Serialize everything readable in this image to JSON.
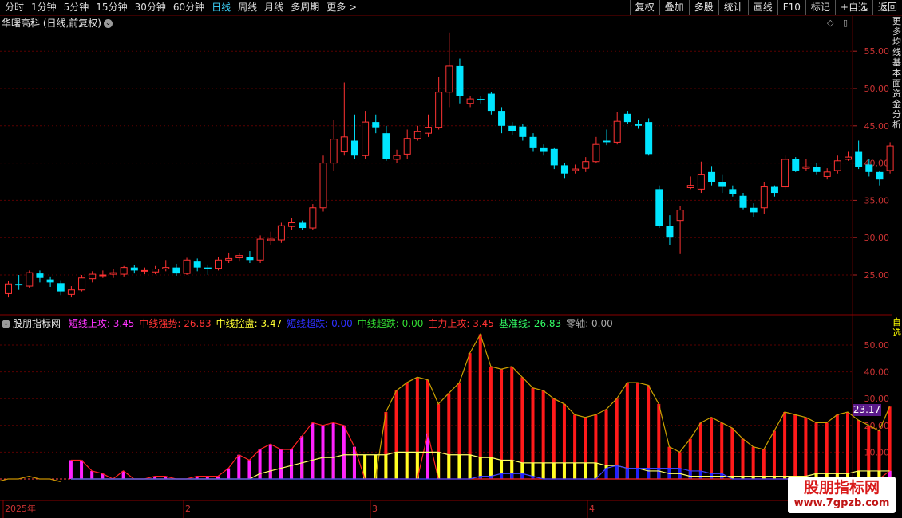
{
  "toolbar": {
    "periods": [
      "分时",
      "1分钟",
      "5分钟",
      "15分钟",
      "30分钟",
      "60分钟",
      "日线",
      "周线",
      "月线",
      "多周期",
      "更多 >"
    ],
    "active_period": "日线",
    "tools": [
      "复权",
      "叠加",
      "多股",
      "统计",
      "画线",
      "F10",
      "标记",
      "+自选",
      "返回"
    ]
  },
  "main_panel": {
    "title": "华曙高科 (日线,前复权)",
    "title_icon": "chevron-down-icon",
    "price_axis": [
      "55.00",
      "50.00",
      "45.00",
      "40.00",
      "35.00",
      "30.00",
      "25.00"
    ],
    "side_text": "更多均线基本面资金分析"
  },
  "indicator_panel": {
    "name": "股朋指标网",
    "items": [
      {
        "label": "短线上攻: ",
        "value": "3.45",
        "color": "#ff33ff"
      },
      {
        "label": "中线强势: ",
        "value": "26.83",
        "color": "#ff3333"
      },
      {
        "label": "中线控盘: ",
        "value": "3.47",
        "color": "#ffff33"
      },
      {
        "label": "短线超跌: ",
        "value": "0.00",
        "color": "#2f2fff"
      },
      {
        "label": "中线超跌: ",
        "value": "0.00",
        "color": "#33dd33"
      },
      {
        "label": "主力上攻: ",
        "value": "3.45",
        "color": "#ff3333"
      },
      {
        "label": "基准线: ",
        "value": "26.83",
        "color": "#33ff66"
      },
      {
        "label": "零轴: ",
        "value": "0.00",
        "color": "#aaaaaa"
      }
    ],
    "axis": [
      "50.00",
      "40.00",
      "30.00",
      "20.00",
      "10.00"
    ],
    "current_value": "23.17",
    "side_text": "自选"
  },
  "time_axis": [
    "2025年",
    "2",
    "3",
    "4"
  ],
  "watermark": {
    "line1": "股朋指标网",
    "line2": "www.7gpzb.com"
  },
  "colors": {
    "up": "#ff3333",
    "down": "#00e5ff",
    "grid": "#5a0000",
    "magenta": "#ff22ff",
    "yellow": "#ffff22",
    "blue": "#2020ff"
  },
  "chart_data": {
    "type": "candlestick",
    "candles": [
      [
        22.5,
        23.8,
        24.2,
        22.0
      ],
      [
        23.8,
        23.6,
        25.0,
        23.0
      ],
      [
        23.5,
        25.3,
        25.6,
        23.2
      ],
      [
        25.2,
        24.6,
        25.6,
        24.0
      ],
      [
        24.4,
        24.0,
        24.8,
        23.4
      ],
      [
        23.9,
        22.8,
        24.3,
        22.3
      ],
      [
        22.4,
        23.0,
        23.5,
        22.0
      ],
      [
        23.0,
        24.6,
        25.0,
        22.8
      ],
      [
        24.5,
        25.1,
        25.5,
        24.0
      ],
      [
        25.0,
        25.0,
        25.6,
        24.6
      ],
      [
        25.1,
        25.3,
        25.8,
        24.6
      ],
      [
        25.1,
        26.0,
        26.2,
        24.8
      ],
      [
        26.0,
        25.6,
        26.3,
        25.2
      ],
      [
        25.6,
        25.6,
        26.0,
        25.1
      ],
      [
        25.4,
        25.8,
        26.2,
        25.1
      ],
      [
        25.8,
        26.0,
        27.0,
        25.5
      ],
      [
        26.0,
        25.2,
        26.5,
        24.9
      ],
      [
        25.2,
        27.0,
        27.3,
        25.0
      ],
      [
        26.8,
        26.0,
        27.2,
        25.5
      ],
      [
        26.0,
        25.8,
        26.4,
        25.0
      ],
      [
        25.9,
        27.0,
        27.4,
        25.6
      ],
      [
        27.0,
        27.2,
        28.0,
        26.6
      ],
      [
        27.3,
        27.6,
        28.0,
        26.8
      ],
      [
        27.4,
        27.0,
        28.2,
        26.6
      ],
      [
        27.0,
        29.8,
        30.3,
        26.6
      ],
      [
        29.6,
        29.8,
        30.8,
        29.0
      ],
      [
        29.7,
        31.6,
        32.0,
        29.3
      ],
      [
        31.5,
        32.0,
        32.6,
        31.0
      ],
      [
        32.0,
        31.3,
        32.3,
        31.0
      ],
      [
        31.3,
        34.0,
        34.5,
        31.0
      ],
      [
        34.0,
        40.0,
        41.0,
        33.5
      ],
      [
        40.0,
        43.2,
        45.8,
        39.0
      ],
      [
        41.5,
        43.5,
        50.8,
        41.0
      ],
      [
        43.0,
        41.0,
        46.5,
        40.5
      ],
      [
        41.0,
        45.5,
        47.0,
        40.5
      ],
      [
        45.5,
        44.8,
        46.5,
        44.0
      ],
      [
        44.0,
        40.5,
        45.0,
        40.3
      ],
      [
        40.5,
        41.0,
        41.8,
        40.0
      ],
      [
        41.2,
        43.3,
        44.5,
        40.5
      ],
      [
        43.3,
        44.2,
        45.0,
        43.0
      ],
      [
        44.0,
        44.8,
        46.5,
        43.5
      ],
      [
        44.8,
        49.5,
        51.5,
        44.5
      ],
      [
        49.5,
        53.0,
        57.5,
        47.5
      ],
      [
        53.0,
        49.0,
        54.0,
        48.0
      ],
      [
        48.0,
        48.6,
        49.0,
        47.5
      ],
      [
        48.6,
        48.5,
        49.0,
        48.0
      ],
      [
        49.3,
        47.0,
        49.5,
        46.5
      ],
      [
        47.0,
        45.0,
        47.5,
        44.0
      ],
      [
        45.0,
        44.3,
        45.5,
        43.8
      ],
      [
        44.9,
        43.5,
        45.2,
        43.0
      ],
      [
        43.5,
        42.0,
        44.0,
        41.5
      ],
      [
        42.0,
        41.5,
        42.5,
        41.0
      ],
      [
        41.9,
        39.7,
        42.0,
        39.2
      ],
      [
        39.7,
        38.6,
        40.0,
        38.0
      ],
      [
        39.0,
        39.2,
        39.8,
        38.6
      ],
      [
        39.3,
        40.2,
        40.8,
        38.8
      ],
      [
        40.2,
        42.5,
        43.5,
        40.0
      ],
      [
        43.0,
        42.8,
        44.5,
        42.4
      ],
      [
        42.8,
        45.6,
        46.8,
        42.5
      ],
      [
        46.6,
        45.5,
        47.0,
        45.2
      ],
      [
        45.3,
        45.0,
        45.8,
        44.6
      ],
      [
        45.5,
        41.2,
        46.0,
        41.0
      ],
      [
        36.5,
        31.6,
        37.0,
        31.3
      ],
      [
        31.6,
        30.0,
        33.0,
        29.0
      ],
      [
        32.3,
        33.7,
        34.2,
        27.8
      ],
      [
        36.7,
        37.0,
        38.2,
        36.5
      ],
      [
        36.5,
        38.5,
        40.2,
        36.0
      ],
      [
        38.8,
        37.5,
        39.6,
        37.0
      ],
      [
        37.5,
        36.8,
        38.5,
        36.0
      ],
      [
        36.5,
        35.8,
        37.0,
        35.5
      ],
      [
        35.6,
        34.0,
        36.0,
        33.8
      ],
      [
        34.0,
        33.4,
        34.6,
        32.8
      ],
      [
        34.0,
        36.8,
        37.5,
        33.2
      ],
      [
        36.8,
        36.0,
        37.0,
        35.5
      ],
      [
        36.8,
        40.5,
        41.0,
        36.5
      ],
      [
        40.5,
        39.0,
        40.8,
        38.8
      ],
      [
        39.3,
        39.5,
        40.5,
        39.0
      ],
      [
        39.5,
        38.8,
        40.0,
        38.5
      ],
      [
        38.2,
        38.8,
        39.3,
        37.8
      ],
      [
        39.0,
        40.3,
        41.0,
        38.6
      ],
      [
        40.5,
        40.8,
        41.5,
        40.3
      ],
      [
        41.5,
        39.5,
        43.0,
        39.2
      ],
      [
        39.8,
        38.8,
        40.5,
        38.2
      ],
      [
        38.8,
        37.8,
        39.0,
        37.0
      ],
      [
        39.0,
        42.3,
        42.8,
        38.6
      ]
    ],
    "indicator": {
      "zhongxian_qiangshi": [
        0,
        0,
        0,
        0,
        0,
        0,
        0,
        0,
        0,
        0,
        0,
        0,
        0,
        0,
        0,
        0,
        0,
        0,
        0,
        0,
        0,
        0,
        0,
        0,
        0,
        0,
        0,
        0,
        0,
        0,
        25,
        33,
        36,
        38,
        37,
        28,
        32,
        36,
        47,
        54,
        42,
        41,
        42,
        38,
        34,
        33,
        30,
        28,
        24,
        23,
        24,
        26,
        30,
        36,
        36,
        35,
        28,
        12,
        10,
        15,
        21,
        23,
        21,
        19,
        15,
        12,
        11,
        18,
        25,
        24,
        23,
        21,
        21,
        24,
        25,
        22,
        20,
        18,
        27
      ],
      "duanxian_shanggong": [
        7,
        7,
        3,
        2,
        0,
        3,
        0,
        0,
        1,
        1,
        0,
        0,
        1,
        1,
        1,
        4,
        9,
        7,
        11,
        13,
        11,
        11,
        16,
        21,
        20,
        21,
        20,
        12,
        0,
        0,
        0,
        0,
        0,
        0,
        17,
        0,
        0,
        0,
        0,
        0,
        0,
        0,
        0,
        0,
        0,
        0,
        0,
        0,
        0,
        0,
        0,
        0,
        0,
        0,
        0,
        0,
        0,
        0,
        0,
        0,
        0,
        0,
        0,
        0,
        0,
        0,
        0,
        0,
        0,
        0,
        0,
        0,
        0,
        0,
        0,
        0,
        0,
        0,
        3
      ],
      "zhongxian_kongpan": [
        0,
        0,
        0,
        0,
        0,
        0,
        0,
        0,
        0,
        0,
        0,
        0,
        0,
        0,
        0,
        0,
        0,
        0,
        2,
        3,
        4,
        5,
        6,
        7,
        8,
        8,
        9,
        9,
        9,
        9,
        9,
        10,
        10,
        10,
        10,
        10,
        9,
        9,
        9,
        8,
        8,
        7,
        7,
        6,
        6,
        6,
        6,
        6,
        6,
        6,
        6,
        5,
        5,
        4,
        4,
        3,
        3,
        2,
        2,
        1,
        1,
        1,
        1,
        1,
        1,
        1,
        1,
        1,
        1,
        1,
        1,
        2,
        2,
        2,
        2,
        3,
        3,
        3,
        3
      ],
      "duanxian_chaodie": [
        0,
        0,
        0,
        0,
        0,
        0,
        0,
        0,
        0,
        0,
        0,
        0,
        0,
        0,
        0,
        0,
        0,
        0,
        0,
        0,
        0,
        0,
        0,
        0,
        0,
        0,
        0,
        0,
        0,
        0,
        0,
        0,
        0,
        0,
        0,
        0,
        0,
        0,
        0,
        1,
        1,
        2,
        2,
        2,
        1,
        0,
        0,
        0,
        0,
        0,
        0,
        4,
        5,
        4,
        4,
        4,
        4,
        4,
        4,
        3,
        3,
        2,
        2,
        0,
        0,
        0,
        0,
        0,
        0,
        0,
        0,
        0,
        0,
        0,
        0,
        0,
        0,
        0,
        0
      ],
      "ma_line": [
        -1,
        -1,
        -1,
        -1,
        0,
        -1,
        -1,
        1,
        -1,
        -1,
        -2,
        -4,
        -3,
        -5,
        -7,
        -7,
        -6,
        -5,
        -2,
        -1,
        -1,
        0,
        0,
        1,
        -1,
        0,
        0,
        1,
        0,
        0,
        -1
      ]
    }
  }
}
